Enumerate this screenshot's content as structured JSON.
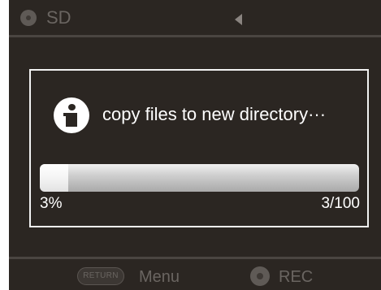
{
  "top_bar": {
    "storage_icon": "sd-card-icon",
    "storage_label": "SD",
    "nav_icon": "left-arrow-icon"
  },
  "dialog": {
    "icon": "info-icon",
    "message": "copy files to new directory···",
    "progress": {
      "percent_label": "3%",
      "percent_value": 3,
      "count_label": "3/100"
    }
  },
  "bottom_bar": {
    "return_button_label": "RETURN",
    "menu_label": "Menu",
    "rec_icon": "record-icon",
    "rec_label": "REC"
  },
  "colors": {
    "background": "#2b2622",
    "dim_text": "#6a6561",
    "dialog_border": "#f2f2f2",
    "text": "#ffffff"
  }
}
